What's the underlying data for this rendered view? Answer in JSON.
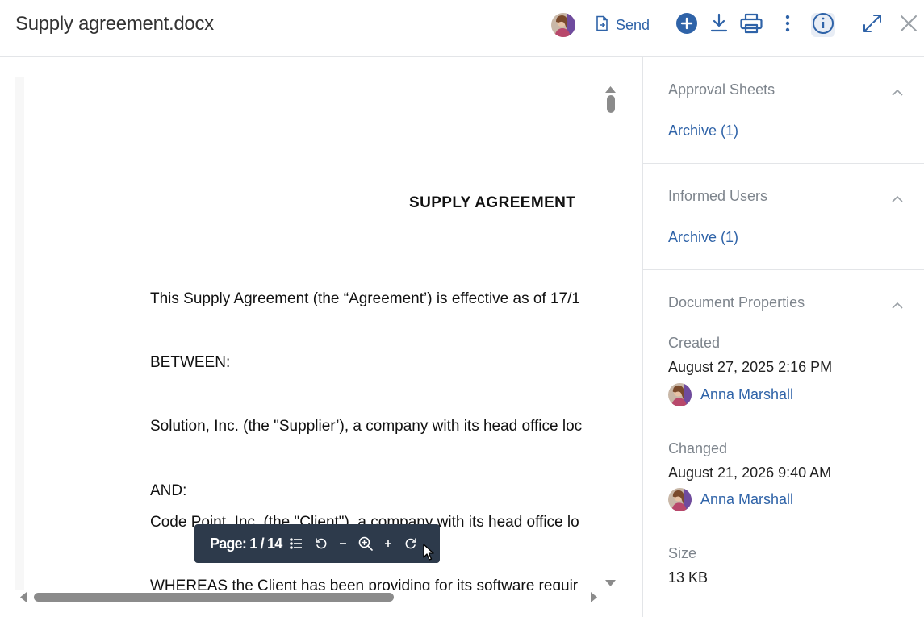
{
  "header": {
    "title": "Supply agreement.docx",
    "send_label": "Send",
    "icons": [
      "user-avatar",
      "send-document-icon",
      "add-icon",
      "download-icon",
      "print-icon",
      "more-icon",
      "info-icon",
      "expand-icon",
      "close-icon"
    ]
  },
  "document": {
    "heading": "SUPPLY AGREEMENT",
    "lines": [
      "This Supply Agreement (the “Agreement’) is effective as of 17/1",
      "BETWEEN:",
      "Solution, Inc. (the \"Supplier’), a company with its head office loc",
      "AND:",
      "Code Point, Inc. (the \"Client\"), a company with its head office lo",
      "WHEREAS the Client has been providing for its software requir"
    ]
  },
  "toolbar": {
    "page_label": "Page: 1 / 14",
    "icons": [
      "list-icon",
      "rotate-left-icon",
      "zoom-out-icon",
      "zoom-icon",
      "zoom-in-icon",
      "rotate-right-icon"
    ]
  },
  "sidebar": {
    "approval": {
      "title": "Approval Sheets",
      "link": "Archive (1)"
    },
    "informed": {
      "title": "Informed Users",
      "link": "Archive (1)"
    },
    "properties": {
      "title": "Document Properties",
      "created_label": "Created",
      "created_value": "August 27, 2025 2:16 PM",
      "created_user": "Anna Marshall",
      "changed_label": "Changed",
      "changed_value": "August 21, 2026 9:40 AM",
      "changed_user": "Anna Marshall",
      "size_label": "Size",
      "size_value": "13 KB"
    }
  },
  "colors": {
    "accent": "#2f63a8",
    "toolbar_bg": "#2d3a4b",
    "muted_text": "#7d848c",
    "divider": "#e3e5e8"
  }
}
